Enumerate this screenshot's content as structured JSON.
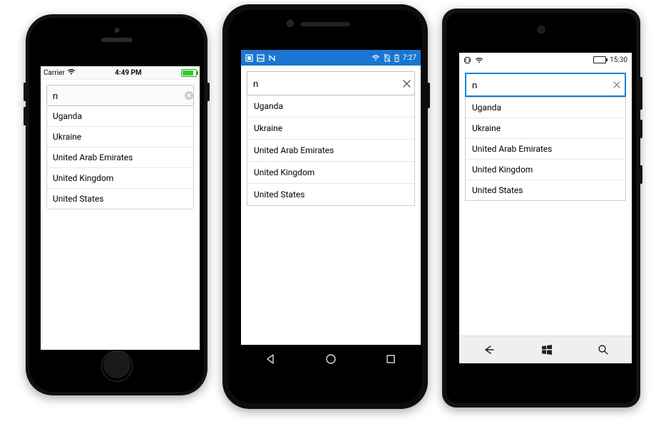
{
  "search": {
    "value": "n",
    "suggestions": [
      "Uganda",
      "Ukraine",
      "United Arab Emirates",
      "United Kingdom",
      "United States"
    ]
  },
  "ios": {
    "carrier": "Carrier",
    "time": "4:49 PM"
  },
  "android": {
    "time": "7:27"
  },
  "wp": {
    "time": "15:30"
  },
  "colors": {
    "android_status": "#1976d2",
    "wp_focus": "#0f82d6"
  }
}
